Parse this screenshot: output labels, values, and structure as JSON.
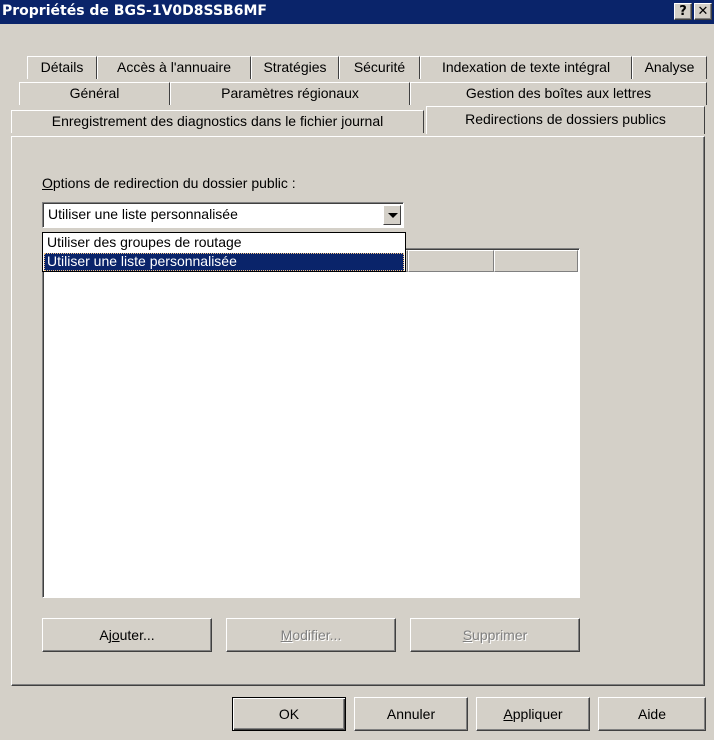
{
  "window": {
    "title": "Propriétés de BGS-1V0D8SSB6MF",
    "help_glyph": "?",
    "close_glyph": "✕"
  },
  "tabs": {
    "row1": [
      "Détails",
      "Accès à l'annuaire",
      "Stratégies",
      "Sécurité",
      "Indexation de texte intégral",
      "Analyse"
    ],
    "row2": [
      "Général",
      "Paramètres régionaux",
      "Gestion des boîtes aux lettres"
    ],
    "row3": [
      "Enregistrement des diagnostics dans le fichier journal",
      "Redirections de dossiers publics"
    ],
    "active": "Redirections de dossiers publics"
  },
  "options": {
    "label_access": "O",
    "label_rest": "ptions de redirection du dossier public :",
    "selected": "Utiliser une liste personnalisée",
    "items": [
      "Utiliser des groupes de routage",
      "Utiliser une liste personnalisée"
    ]
  },
  "actions": {
    "add_pre": "Aj",
    "add_access": "o",
    "add_post": "uter...",
    "modify_access": "M",
    "modify_post": "odifier...",
    "delete_access": "S",
    "delete_post": "upprimer"
  },
  "dialog_buttons": {
    "ok": "OK",
    "cancel": "Annuler",
    "apply_access": "A",
    "apply_post": "ppliquer",
    "help": "Aide"
  }
}
